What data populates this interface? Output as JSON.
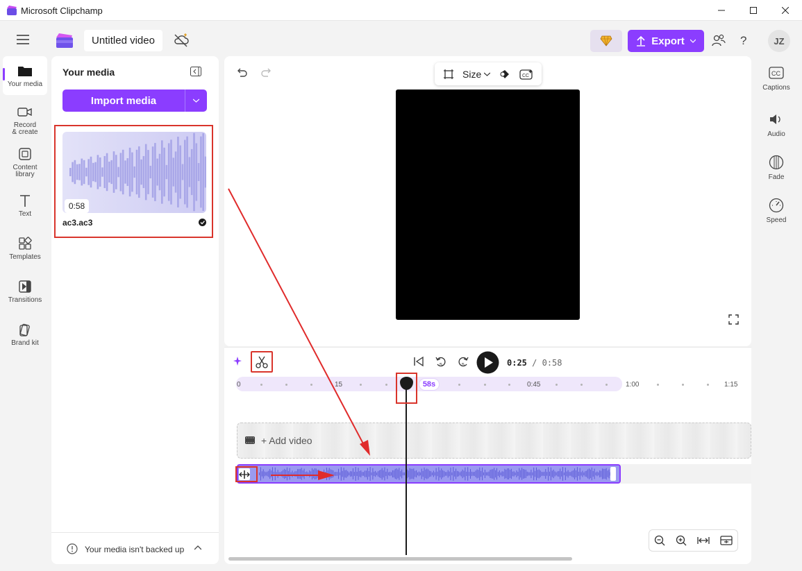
{
  "window": {
    "title": "Microsoft Clipchamp"
  },
  "header": {
    "project_title": "Untitled video",
    "export_label": "Export",
    "avatar_initials": "JZ"
  },
  "nav": {
    "items": [
      {
        "label": "Your media"
      },
      {
        "label": "Record & create"
      },
      {
        "label": "Content library"
      },
      {
        "label": "Text"
      },
      {
        "label": "Templates"
      },
      {
        "label": "Transitions"
      },
      {
        "label": "Brand kit"
      }
    ]
  },
  "media": {
    "heading": "Your media",
    "import_label": "Import media",
    "item": {
      "duration": "0:58",
      "filename": "ac3.ac3"
    },
    "backup_notice": "Your media isn't backed up"
  },
  "preview": {
    "size_label": "Size"
  },
  "player": {
    "current_time": "0:25",
    "separator": "/",
    "total_time": "0:58"
  },
  "timeline": {
    "ruler_labels": [
      "0",
      "15",
      "0:45",
      "1:00",
      "1:15"
    ],
    "playhead_label": "58s",
    "add_video_label": "+ Add video"
  },
  "right_panel": {
    "items": [
      {
        "label": "Captions"
      },
      {
        "label": "Audio"
      },
      {
        "label": "Fade"
      },
      {
        "label": "Speed"
      }
    ]
  },
  "colors": {
    "accent": "#8b3dff",
    "annotation": "#d9342b",
    "audio_clip": "#9a9af0"
  }
}
